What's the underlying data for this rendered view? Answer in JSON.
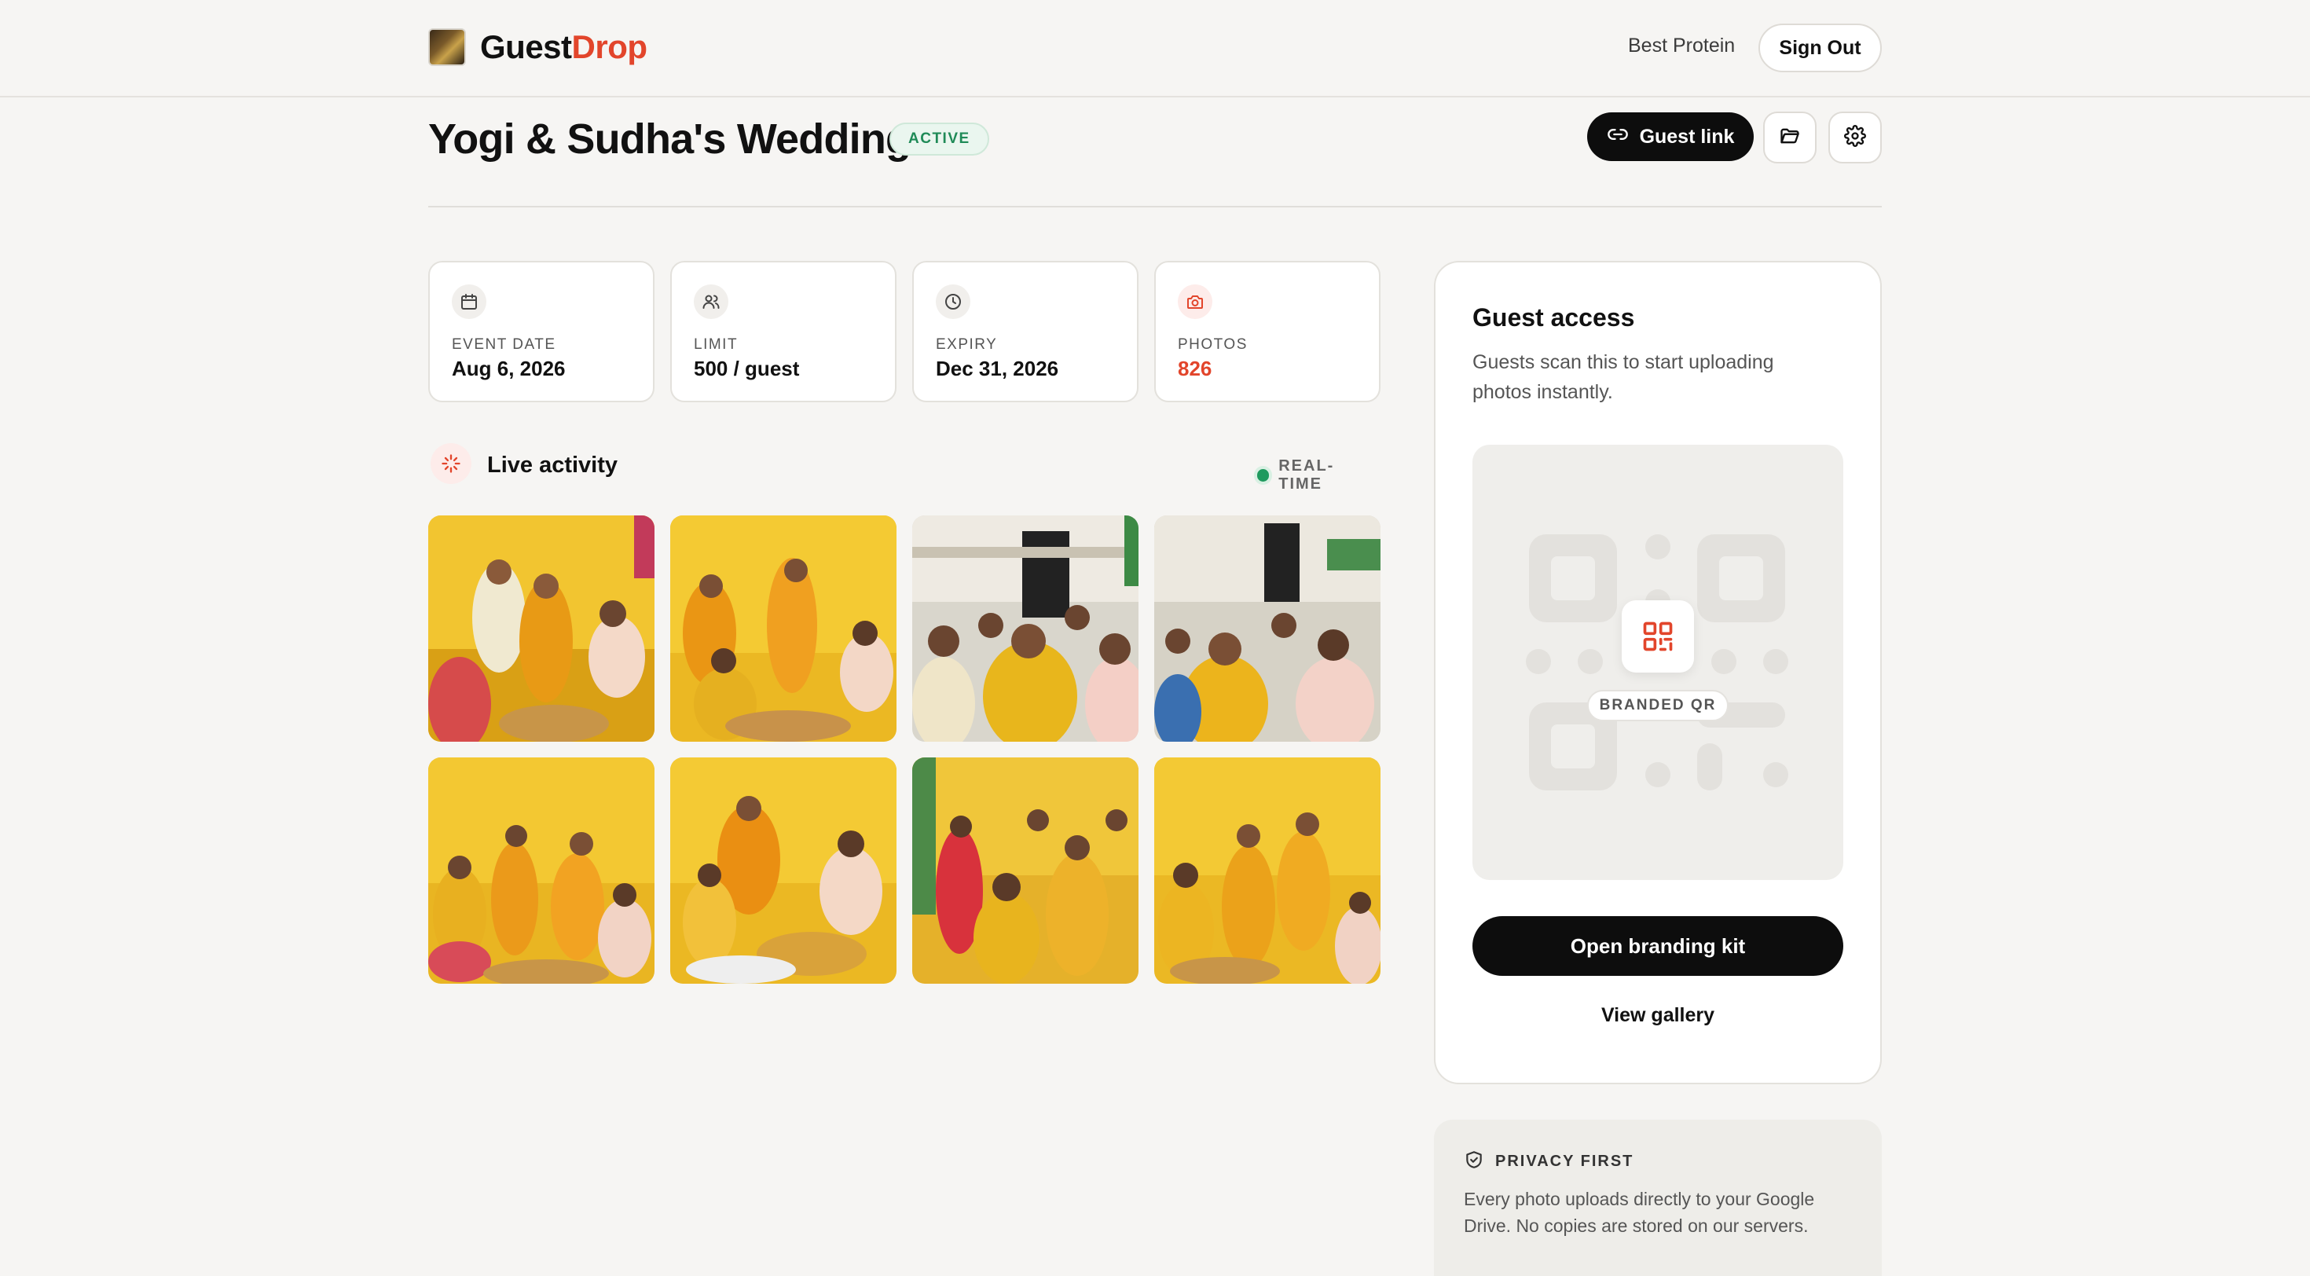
{
  "header": {
    "brand_part1": "Guest",
    "brand_part2": "Drop",
    "user_name": "Best Protein",
    "sign_out_label": "Sign Out"
  },
  "event": {
    "title": "Yogi & Sudha's Wedding",
    "status": "ACTIVE",
    "guest_link_label": "Guest link",
    "folder_icon": "folder-icon",
    "settings_icon": "gear-icon"
  },
  "stats": [
    {
      "label": "EVENT DATE",
      "value": "Aug 6, 2026",
      "icon": "calendar-icon"
    },
    {
      "label": "LIMIT",
      "value": "500 / guest",
      "icon": "users-icon"
    },
    {
      "label": "EXPIRY",
      "value": "Dec 31, 2026",
      "icon": "clock-icon"
    },
    {
      "label": "PHOTOS",
      "value": "826",
      "icon": "camera-icon"
    }
  ],
  "activity": {
    "title": "Live activity",
    "realtime_label": "REAL-TIME",
    "photo_count_shown": 8
  },
  "guest_access": {
    "title": "Guest access",
    "description": "Guests scan this to start uploading photos instantly.",
    "qr_tag": "BRANDED QR",
    "branding_button": "Open branding kit",
    "gallery_link": "View gallery"
  },
  "privacy": {
    "label": "PRIVACY FIRST",
    "text": "Every photo uploads directly to your Google Drive. No copies are stored on our servers."
  },
  "colors": {
    "accent": "#e2452b",
    "active_green": "#1f8a57",
    "background": "#f6f5f3",
    "dark": "#0d0d0d"
  }
}
